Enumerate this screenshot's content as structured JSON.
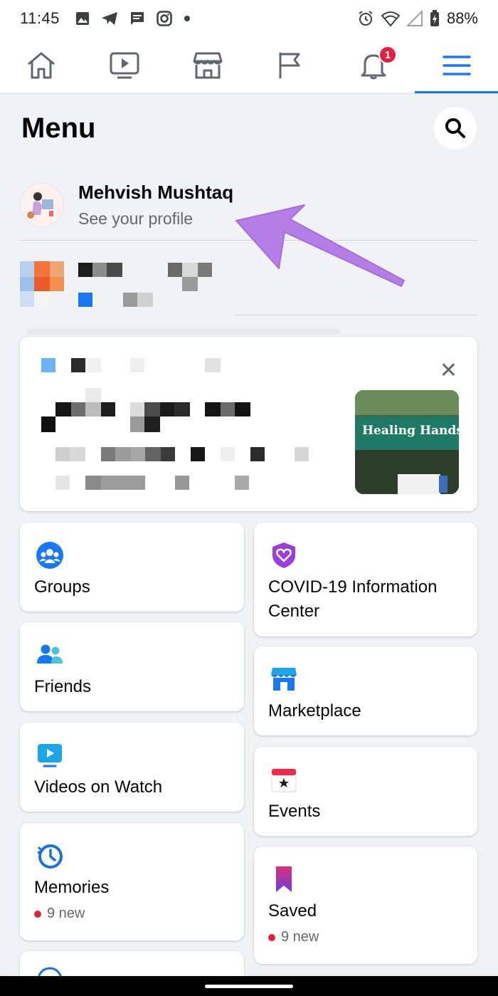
{
  "status": {
    "time": "11:45",
    "battery": "88%"
  },
  "nav": {
    "items": [
      {
        "name": "home-icon"
      },
      {
        "name": "watch-icon"
      },
      {
        "name": "marketplace-icon"
      },
      {
        "name": "pages-flag-icon"
      },
      {
        "name": "notifications-bell-icon",
        "badge": "1"
      },
      {
        "name": "menu-hamburger-icon",
        "active": true
      }
    ],
    "accent": "#1877f2"
  },
  "header": {
    "title": "Menu"
  },
  "profile": {
    "name": "Mehvish Mushtaq",
    "subtitle": "See your profile"
  },
  "shortcuts_left": [
    {
      "label": "Groups",
      "icon": "groups-icon"
    },
    {
      "label": "Friends",
      "icon": "friends-icon"
    },
    {
      "label": "Videos on Watch",
      "icon": "video-icon"
    },
    {
      "label": "Memories",
      "icon": "memories-clock-icon",
      "new": "9 new"
    }
  ],
  "shortcuts_right": [
    {
      "label": "COVID-19 Information Center",
      "icon": "covid-heart-shield-icon"
    },
    {
      "label": "Marketplace",
      "icon": "marketplace-shop-icon"
    },
    {
      "label": "Events",
      "icon": "events-calendar-icon"
    },
    {
      "label": "Saved",
      "icon": "saved-bookmark-icon",
      "new": "9 new"
    }
  ],
  "featured_thumb_text": "Healing Hands Clin"
}
